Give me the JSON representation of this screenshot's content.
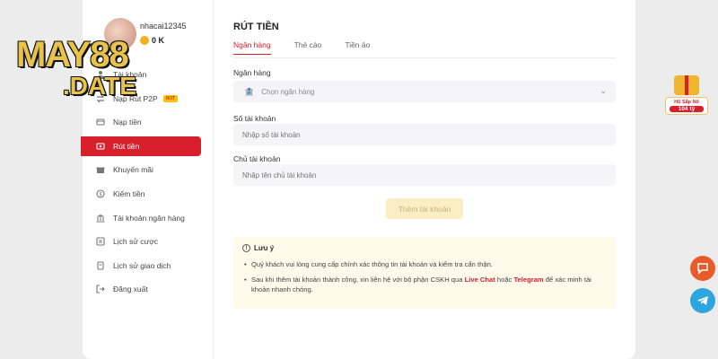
{
  "user": {
    "username": "nhacai12345",
    "balance": "0 K"
  },
  "logo": {
    "line1": "MAY88",
    "line2": ".DATE"
  },
  "menu": [
    {
      "label": "Tài khoản",
      "icon": "user-icon"
    },
    {
      "label": "Nạp Rút P2P",
      "icon": "exchange-icon",
      "badge": "HOT"
    },
    {
      "label": "Nạp tiền",
      "icon": "deposit-icon"
    },
    {
      "label": "Rút tiền",
      "icon": "withdraw-icon",
      "active": true
    },
    {
      "label": "Khuyến mãi",
      "icon": "gift-icon"
    },
    {
      "label": "Kiếm tiền",
      "icon": "money-icon"
    },
    {
      "label": "Tài khoản ngân hàng",
      "icon": "bank-icon"
    },
    {
      "label": "Lịch sử cược",
      "icon": "history-icon"
    },
    {
      "label": "Lịch sử giao dịch",
      "icon": "transaction-icon"
    },
    {
      "label": "Đăng xuất",
      "icon": "logout-icon"
    }
  ],
  "page": {
    "title": "RÚT TIỀN",
    "tabs": [
      {
        "label": "Ngân hàng",
        "active": true
      },
      {
        "label": "Thẻ cào"
      },
      {
        "label": "Tiền ảo"
      }
    ]
  },
  "form": {
    "bank_label": "Ngân hàng",
    "bank_placeholder": "Chọn ngân hàng",
    "account_number_label": "Số tài khoản",
    "account_number_placeholder": "Nhập số tài khoản",
    "account_holder_label": "Chủ tài khoản",
    "account_holder_placeholder": "Nhập tên chủ tài khoản",
    "add_button": "Thêm tài khoản"
  },
  "note": {
    "title": "Lưu ý",
    "item1": "Quý khách vui lòng cung cấp chính xác thông tin tài khoản và kiểm tra cẩn thận.",
    "item2_a": "Sau khi thêm tài khoản thành công, xin liên hệ với bộ phận CSKH qua ",
    "item2_live": "Live Chat",
    "item2_b": " hoặc ",
    "item2_tg": "Telegram",
    "item2_c": " để xác minh tài khoản nhanh chóng."
  },
  "jackpot": {
    "label": "Hũ Sắp Nổ",
    "amount": "104 tỷ"
  },
  "colors": {
    "accent": "#d8202c",
    "chat": "#e95a2b",
    "telegram": "#2ca5e0"
  }
}
